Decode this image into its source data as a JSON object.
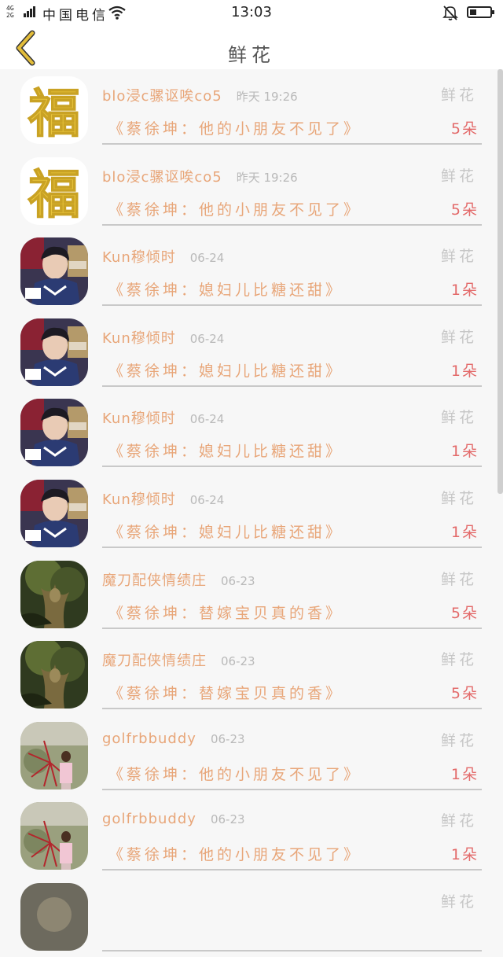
{
  "status_bar": {
    "network_top": "4G",
    "network_bottom": "2G",
    "carrier": "中国电信",
    "time": "13:03"
  },
  "header": {
    "title": "鲜花"
  },
  "colors": {
    "accent": "#e8a679",
    "count": "#e36a6a",
    "muted": "#b9b9b9",
    "back_icon": "#d9b22e"
  },
  "records": [
    {
      "user": "blo浸c骡讴唉co5",
      "time": "昨天 19:26",
      "type": "鲜花",
      "article": "《蔡徐坤：他的小朋友不见了》",
      "count": "5朵",
      "avatar": "fu-character"
    },
    {
      "user": "blo浸c骡讴唉co5",
      "time": "昨天 19:26",
      "type": "鲜花",
      "article": "《蔡徐坤：他的小朋友不见了》",
      "count": "5朵",
      "avatar": "fu-character"
    },
    {
      "user": "Kun穆倾时",
      "time": "06-24",
      "type": "鲜花",
      "article": "《蔡徐坤：媳妇儿比糖还甜》",
      "count": "1朵",
      "avatar": "boy-photo"
    },
    {
      "user": "Kun穆倾时",
      "time": "06-24",
      "type": "鲜花",
      "article": "《蔡徐坤：媳妇儿比糖还甜》",
      "count": "1朵",
      "avatar": "boy-photo"
    },
    {
      "user": "Kun穆倾时",
      "time": "06-24",
      "type": "鲜花",
      "article": "《蔡徐坤：媳妇儿比糖还甜》",
      "count": "1朵",
      "avatar": "boy-photo"
    },
    {
      "user": "Kun穆倾时",
      "time": "06-24",
      "type": "鲜花",
      "article": "《蔡徐坤：媳妇儿比糖还甜》",
      "count": "1朵",
      "avatar": "boy-photo"
    },
    {
      "user": "魔刀配侠情绩庄",
      "time": "06-23",
      "type": "鲜花",
      "article": "《蔡徐坤：替嫁宝贝真的香》",
      "count": "5朵",
      "avatar": "tree-art"
    },
    {
      "user": "魔刀配侠情绩庄",
      "time": "06-23",
      "type": "鲜花",
      "article": "《蔡徐坤：替嫁宝贝真的香》",
      "count": "5朵",
      "avatar": "tree-art"
    },
    {
      "user": "golfrbbuddy",
      "time": "06-23",
      "type": "鲜花",
      "article": "《蔡徐坤：他的小朋友不见了》",
      "count": "1朵",
      "avatar": "girl-photo"
    },
    {
      "user": "golfrbbuddy",
      "time": "06-23",
      "type": "鲜花",
      "article": "《蔡徐坤：他的小朋友不见了》",
      "count": "1朵",
      "avatar": "girl-photo"
    },
    {
      "user": "",
      "time": "",
      "type": "鲜花",
      "article": "",
      "count": "",
      "avatar": "partial"
    }
  ]
}
